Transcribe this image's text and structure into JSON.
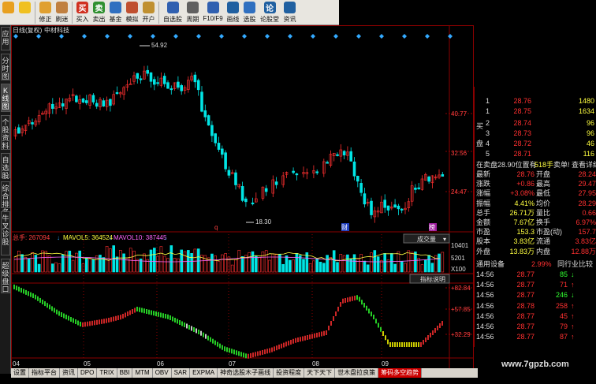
{
  "toolbar": [
    {
      "label": "",
      "icon": "home-icon",
      "color": "#e8a020"
    },
    {
      "label": "",
      "icon": "back-arrow-icon",
      "color": "#f0c020"
    },
    {
      "label": "修正",
      "icon": "refresh-icon",
      "color": "#e0a030"
    },
    {
      "label": "刷迷",
      "icon": "clock-icon",
      "color": "#c08040"
    },
    {
      "label": "买入",
      "icon": "buy-icon",
      "color": "#d03020",
      "glyph": "买"
    },
    {
      "label": "卖出",
      "icon": "sell-icon",
      "color": "#309030",
      "glyph": "卖"
    },
    {
      "label": "基金",
      "icon": "fund-icon",
      "color": "#3070c0"
    },
    {
      "label": "模拟",
      "icon": "simulate-icon",
      "color": "#c05030"
    },
    {
      "label": "开户",
      "icon": "lock-icon",
      "color": "#c09030"
    },
    {
      "label": "自选股",
      "icon": "favorites-icon",
      "color": "#3060b0"
    },
    {
      "label": "周期",
      "icon": "period-icon",
      "color": "#606060"
    },
    {
      "label": "F10/F9",
      "icon": "f10-icon",
      "color": "#3060b0"
    },
    {
      "label": "画线",
      "icon": "draw-icon",
      "color": "#2060a0"
    },
    {
      "label": "选股",
      "icon": "select-stock-icon",
      "color": "#3070c0"
    },
    {
      "label": "论股堂",
      "icon": "forum-icon",
      "color": "#2060a0",
      "glyph": "论"
    },
    {
      "label": "资讯",
      "icon": "news-icon",
      "color": "#2060a0"
    }
  ],
  "left_tabs": [
    {
      "label": "应用",
      "active": false
    },
    {
      "label": "分时图",
      "active": false
    },
    {
      "label": "K线图",
      "active": true
    },
    {
      "label": "个股资料",
      "active": false
    },
    {
      "label": "自选股",
      "active": false
    },
    {
      "label": "综合排名",
      "active": false
    },
    {
      "label": "牛叉诊股",
      "active": false
    },
    {
      "label": "超级盘口",
      "active": false
    }
  ],
  "chart": {
    "header": "日线(复权)",
    "stock_name": "中材科技",
    "price_labels": {
      "p1": "40.77",
      "p2": "32.56",
      "p3": "24.47"
    },
    "high_marker": "54.92",
    "low_marker": "18.30",
    "event_markers": [
      "q",
      "财",
      "榜"
    ],
    "volume_header": {
      "total_label": "总手: 267094",
      "ma5_label": "MAVOL5: 364524",
      "ma10_label": "MAVOL10: 387445"
    },
    "volume_dropdown": "成交量",
    "volume_scale": [
      "10401",
      "5201",
      "X100"
    ],
    "indicator_button": "指标说明",
    "indicator_scale": [
      "+82.84",
      "+57.85",
      "+32.29"
    ],
    "month_labels": [
      "04",
      "05",
      "06",
      "07",
      "08",
      "09"
    ]
  },
  "panel": {
    "ask_side_label": "买",
    "bid_side_label": "盘",
    "asks": [
      {
        "level": "1",
        "price": "28.76",
        "vol": "1480"
      },
      {
        "level": "1",
        "price": "28.75",
        "vol": "1634"
      }
    ],
    "bids": [
      {
        "level": "2",
        "price": "28.74",
        "vol": "96"
      },
      {
        "level": "3",
        "price": "28.73",
        "vol": "96"
      },
      {
        "level": "4",
        "price": "28.72",
        "vol": "46"
      },
      {
        "level": "5",
        "price": "28.71",
        "vol": "116"
      }
    ],
    "order_line": {
      "left": "在卖盘28.90位置有",
      "mid": "518手",
      "right": "卖单! 查看详细"
    },
    "quote": [
      {
        "k1": "最新",
        "v1": "28.76",
        "k2": "开盘",
        "v2": "28.24"
      },
      {
        "k1": "涨跌",
        "v1": "+0.86",
        "k2": "最高",
        "v2": "29.47"
      },
      {
        "k1": "涨幅",
        "v1": "+3.08%",
        "k2": "最低",
        "v2": "27.95"
      },
      {
        "k1": "振幅",
        "v1": "4.41%",
        "k2": "均价",
        "v2": "28.29"
      },
      {
        "k1": "总手",
        "v1": "26.71万",
        "k2": "量比",
        "v2": "0.66"
      },
      {
        "k1": "金额",
        "v1": "7.67亿",
        "k2": "换手",
        "v2": "6.97%"
      },
      {
        "k1": "市盈",
        "v1": "153.3",
        "k2": "市盈(动)",
        "v2": "157.7"
      },
      {
        "k1": "股本",
        "v1": "3.83亿",
        "k2": "流通",
        "v2": "3.83亿"
      },
      {
        "k1": "外盘",
        "v1": "13.83万",
        "k2": "内盘",
        "v2": "12.88万"
      }
    ],
    "tabs": {
      "left": "通用设备",
      "mid": "2.99%",
      "right": "同行业比较"
    },
    "ticks": [
      {
        "time": "14:56",
        "price": "28.77",
        "vol": "85",
        "dir": "down"
      },
      {
        "time": "14:56",
        "price": "28.77",
        "vol": "71",
        "dir": "up"
      },
      {
        "time": "14:56",
        "price": "28.77",
        "vol": "246",
        "dir": "down"
      },
      {
        "time": "14:56",
        "price": "28.78",
        "vol": "258",
        "dir": "up"
      },
      {
        "time": "14:56",
        "price": "28.77",
        "vol": "45",
        "dir": "up"
      },
      {
        "time": "14:56",
        "price": "28.77",
        "vol": "79",
        "dir": "up"
      },
      {
        "time": "14:56",
        "price": "28.77",
        "vol": "87",
        "dir": "up"
      }
    ]
  },
  "bottom_tabs": [
    {
      "label": "设置",
      "active": false
    },
    {
      "label": "指标平台",
      "active": false
    },
    {
      "label": "资讯",
      "active": false
    },
    {
      "label": "DPO",
      "active": false
    },
    {
      "label": "TRIX",
      "active": false
    },
    {
      "label": "BBI",
      "active": false
    },
    {
      "label": "MTM",
      "active": false
    },
    {
      "label": "OBV",
      "active": false
    },
    {
      "label": "SAR",
      "active": false
    },
    {
      "label": "EXPMA",
      "active": false
    },
    {
      "label": "神奇选股木子画线",
      "active": false
    },
    {
      "label": "投资程度",
      "active": false
    },
    {
      "label": "天下天下",
      "active": false
    },
    {
      "label": "世木盘拉良策",
      "active": false
    },
    {
      "label": "筹码多空趋势",
      "active": true
    }
  ],
  "watermark": "www.7gpzb.com",
  "colors": {
    "up": "#ff3030",
    "down": "#00e5e5",
    "green": "#30ff30",
    "yellow": "#ffff00",
    "white": "#ffffff",
    "grid": "#8b0000"
  }
}
